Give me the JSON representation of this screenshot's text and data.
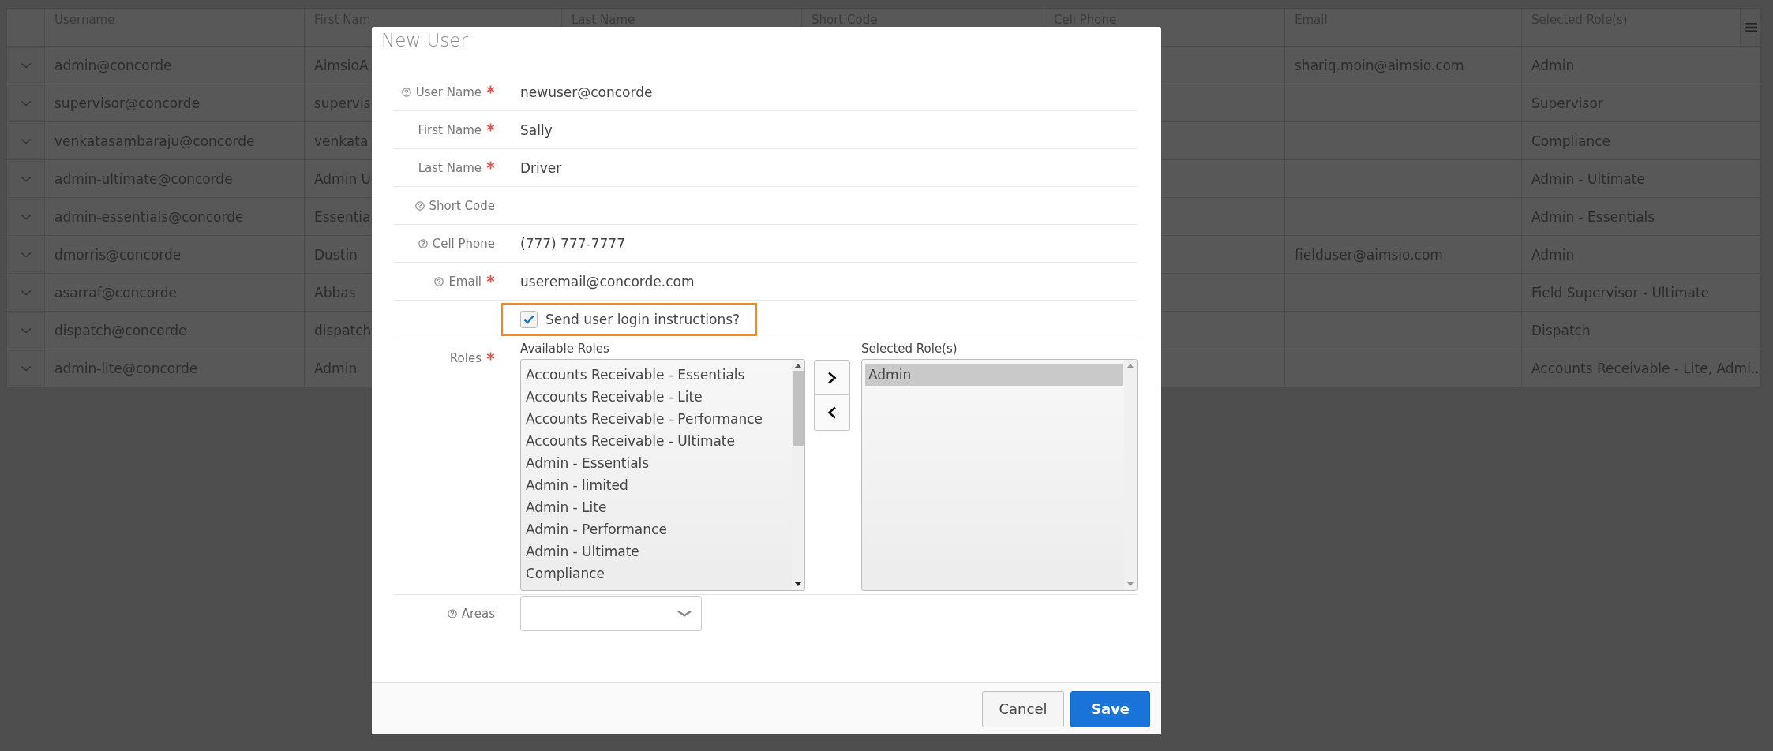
{
  "grid": {
    "columns": [
      "Username",
      "First Nam",
      "Last Name",
      "Short Code",
      "Cell Phone",
      "Email",
      "Selected Role(s)"
    ],
    "rows": [
      {
        "username": "admin@concorde",
        "first_name": "AimsioA",
        "email": "shariq.moin@aimsio.com",
        "roles": "Admin"
      },
      {
        "username": "supervisor@concorde",
        "first_name": "supervis",
        "roles": "Supervisor"
      },
      {
        "username": "venkatasambaraju@concorde",
        "first_name": "venkata",
        "roles": "Compliance"
      },
      {
        "username": "admin-ultimate@concorde",
        "first_name": "Admin U",
        "roles": "Admin - Ultimate"
      },
      {
        "username": "admin-essentials@concorde",
        "first_name": "Essentia",
        "roles": "Admin - Essentials"
      },
      {
        "username": "dmorris@concorde",
        "first_name": "Dustin",
        "email": "fielduser@aimsio.com",
        "roles": "Admin"
      },
      {
        "username": "asarraf@concorde",
        "first_name": "Abbas",
        "roles": "Field Supervisor - Ultimate"
      },
      {
        "username": "dispatch@concorde",
        "first_name": "dispatch",
        "roles": "Dispatch"
      },
      {
        "username": "admin-lite@concorde",
        "first_name": "Admin",
        "roles": "Accounts Receivable - Lite, Admi..."
      }
    ]
  },
  "modal": {
    "title": "New User",
    "fields": [
      {
        "label": "User Name",
        "value": "newuser@concorde",
        "required": true,
        "help": true
      },
      {
        "label": "First Name",
        "value": "Sally",
        "required": true,
        "help": false
      },
      {
        "label": "Last Name",
        "value": "Driver",
        "required": true,
        "help": false
      },
      {
        "label": "Short Code",
        "required": false,
        "help": true
      },
      {
        "label": "Cell Phone",
        "value": "(777) 777-7777",
        "required": false,
        "help": true
      },
      {
        "label": "Email",
        "value": "useremail@concorde.com",
        "required": true,
        "help": true
      }
    ],
    "send_instructions": {
      "label": "Send user login instructions?",
      "checked": true,
      "highlighted": true
    },
    "roles": {
      "label": "Roles",
      "required": true,
      "available_label": "Available Roles",
      "selected_label": "Selected Role(s)",
      "available": [
        {
          "label": "Accounts Receivable - Essentials",
          "selected": false
        },
        {
          "label": "Accounts Receivable - Lite",
          "selected": false
        },
        {
          "label": "Accounts Receivable - Performance",
          "selected": false
        },
        {
          "label": "Accounts Receivable - Ultimate",
          "selected": false
        },
        {
          "label": "Admin - Essentials",
          "selected": false
        },
        {
          "label": "Admin - limited",
          "selected": false
        },
        {
          "label": "Admin - Lite",
          "selected": false
        },
        {
          "label": "Admin - Performance",
          "selected": false
        },
        {
          "label": "Admin - Ultimate",
          "selected": false
        },
        {
          "label": "Compliance",
          "selected": false
        }
      ],
      "selected": [
        {
          "label": "Admin",
          "selected": true
        }
      ]
    },
    "areas": {
      "label": "Areas",
      "help": true
    },
    "buttons": [
      {
        "label": "Cancel",
        "kind": "secondary"
      },
      {
        "label": "Save",
        "kind": "primary"
      }
    ]
  }
}
